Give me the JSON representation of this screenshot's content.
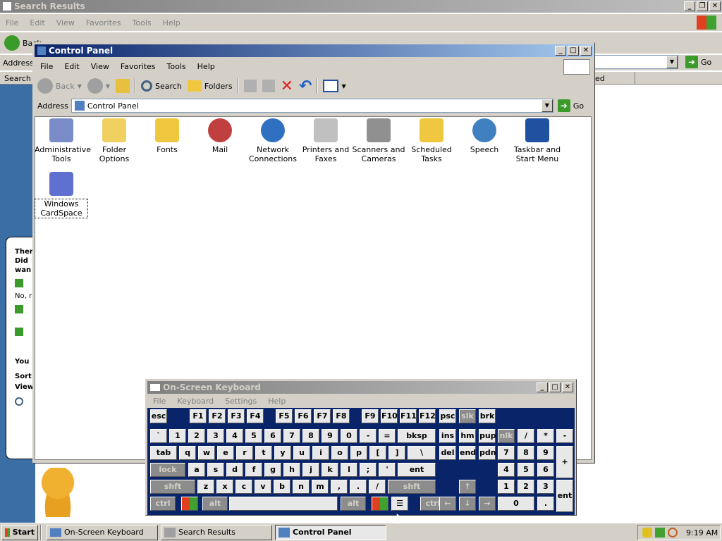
{
  "bg_window": {
    "title": "Search Results",
    "menu": [
      "File",
      "Edit",
      "View",
      "Favorites",
      "Tools",
      "Help"
    ],
    "address_label": "Address",
    "search_label": "Search",
    "back_label": "Back",
    "go_label": "Go",
    "column_fragment": "ed",
    "assistant": {
      "line1": "Ther",
      "line2": "Did",
      "line3": "wan",
      "line4": "No, r",
      "line5": "You",
      "line6": "Sort",
      "line7": "View"
    }
  },
  "control_panel": {
    "title": "Control Panel",
    "menu": [
      "File",
      "Edit",
      "View",
      "Favorites",
      "Tools",
      "Help"
    ],
    "toolbar": {
      "back": "Back",
      "search": "Search",
      "folders": "Folders"
    },
    "address_label": "Address",
    "address_value": "Control Panel",
    "go_label": "Go",
    "icons": [
      {
        "label": "Administrative Tools",
        "icon": "admin-tools-icon",
        "color": "#7a8cc8"
      },
      {
        "label": "Folder Options",
        "icon": "folder-options-icon",
        "color": "#f0d060"
      },
      {
        "label": "Fonts",
        "icon": "fonts-folder-icon",
        "color": "#f0c840"
      },
      {
        "label": "Mail",
        "icon": "mail-icon",
        "color": "#c04040"
      },
      {
        "label": "Network Connections",
        "icon": "network-icon",
        "color": "#3070c0"
      },
      {
        "label": "Printers and Faxes",
        "icon": "printer-icon",
        "color": "#c0c0c0"
      },
      {
        "label": "Scanners and Cameras",
        "icon": "scanner-icon",
        "color": "#909090"
      },
      {
        "label": "Scheduled Tasks",
        "icon": "scheduled-tasks-icon",
        "color": "#f0c840"
      },
      {
        "label": "Speech",
        "icon": "speech-icon",
        "color": "#4080c0"
      },
      {
        "label": "Taskbar and Start Menu",
        "icon": "taskbar-icon",
        "color": "#2050a0"
      },
      {
        "label": "Windows CardSpace",
        "icon": "cardspace-icon",
        "color": "#6070d0"
      }
    ]
  },
  "osk": {
    "title": "On-Screen Keyboard",
    "menu": [
      "File",
      "Keyboard",
      "Settings",
      "Help"
    ],
    "row1": [
      "esc",
      "F1",
      "F2",
      "F3",
      "F4",
      "F5",
      "F6",
      "F7",
      "F8",
      "F9",
      "F10",
      "F11",
      "F12",
      "psc",
      "slk",
      "brk"
    ],
    "row2": [
      "`",
      "1",
      "2",
      "3",
      "4",
      "5",
      "6",
      "7",
      "8",
      "9",
      "0",
      "-",
      "=",
      "bksp",
      "ins",
      "hm",
      "pup",
      "nlk",
      "/",
      "*",
      "-"
    ],
    "row3": [
      "tab",
      "q",
      "w",
      "e",
      "r",
      "t",
      "y",
      "u",
      "i",
      "o",
      "p",
      "[",
      "]",
      "\\",
      "del",
      "end",
      "pdn",
      "7",
      "8",
      "9",
      "+"
    ],
    "row4": [
      "lock",
      "a",
      "s",
      "d",
      "f",
      "g",
      "h",
      "j",
      "k",
      "l",
      ";",
      "'",
      "ent",
      "4",
      "5",
      "6"
    ],
    "row5": [
      "shft",
      "z",
      "x",
      "c",
      "v",
      "b",
      "n",
      "m",
      ",",
      ".",
      "/",
      "shft",
      "1",
      "2",
      "3",
      "ent"
    ],
    "row6": [
      "ctrl",
      "alt",
      "alt",
      "ctrl",
      "0",
      "."
    ]
  },
  "taskbar": {
    "start": "Start",
    "items": [
      "On-Screen Keyboard",
      "Search Results",
      "Control Panel"
    ],
    "clock": "9:19 AM"
  },
  "colors": {
    "desktop": "#3a6ea5",
    "title_active": "#0a246a",
    "title_inactive": "#808080",
    "osk_bg": "#0a246a"
  }
}
